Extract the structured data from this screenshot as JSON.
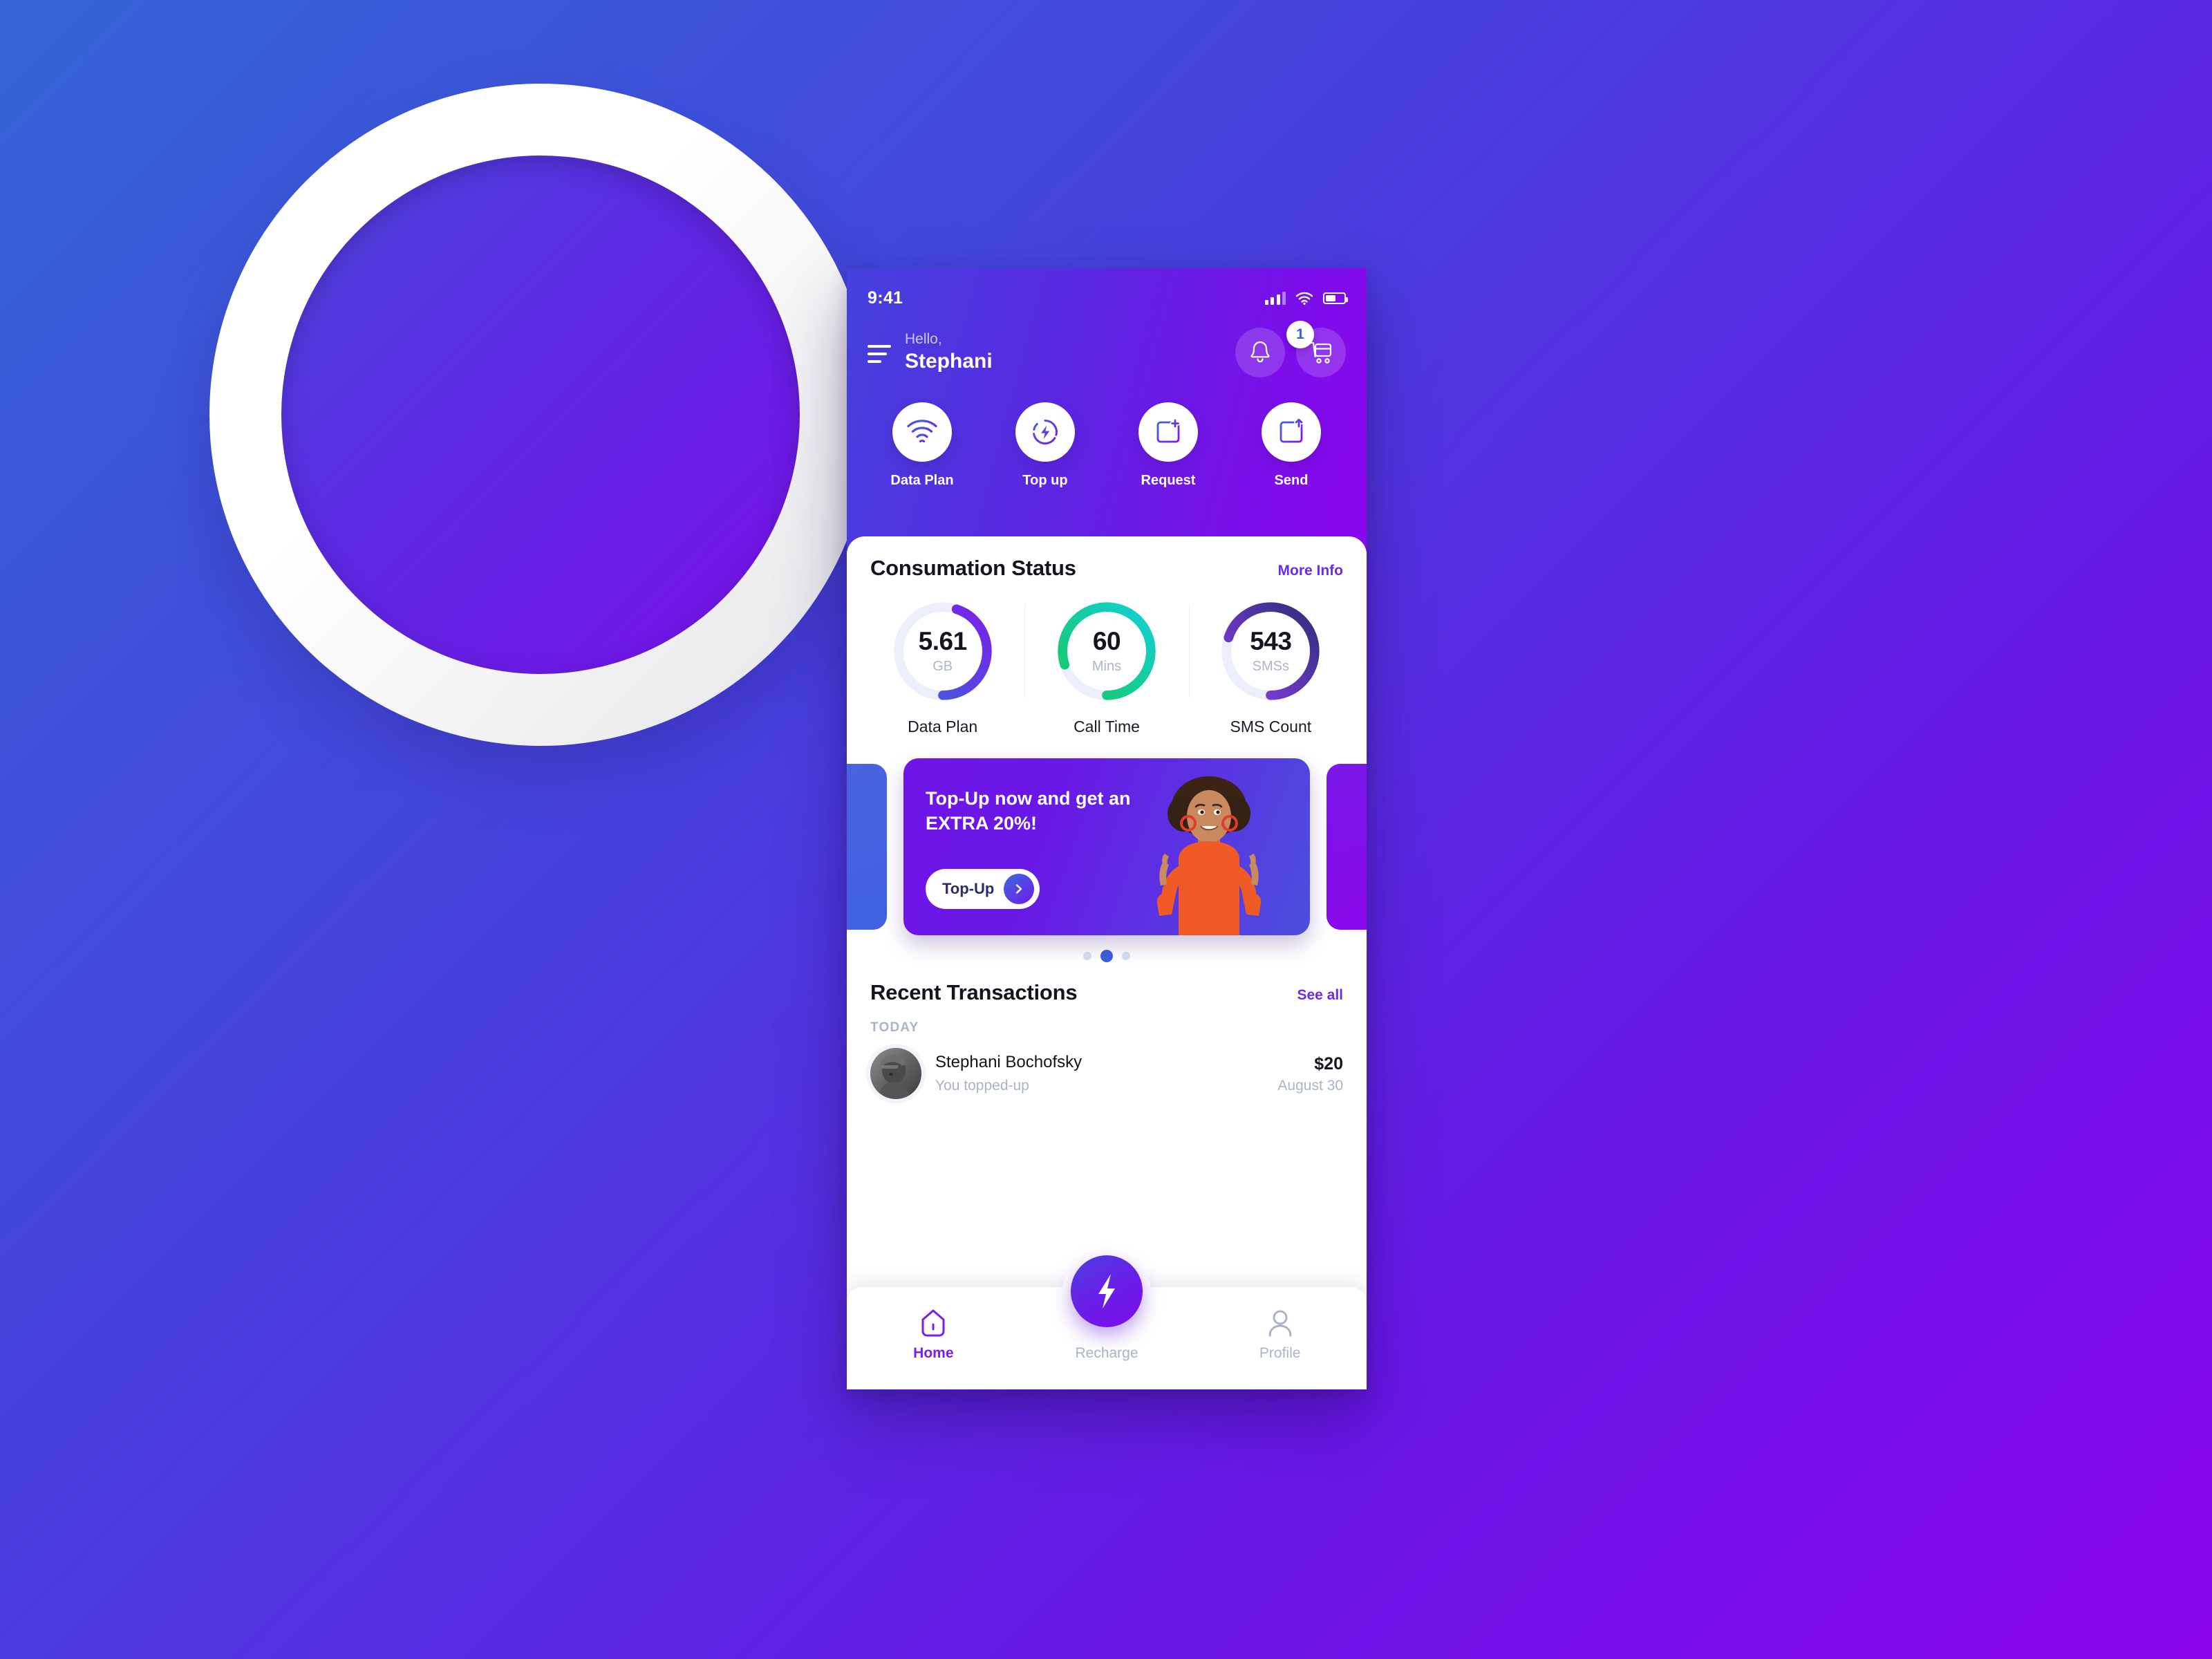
{
  "background": {
    "gradient_from": "#3565d8",
    "gradient_to": "#8a05ec",
    "ring_color": "#ffffff"
  },
  "phone": {
    "status_bar": {
      "time": "9:41",
      "signal_icon": "signal-bars-icon",
      "wifi_icon": "wifi-icon",
      "battery_icon": "battery-icon",
      "battery_level": "55"
    },
    "header": {
      "menu_icon": "hamburger-menu-icon",
      "greeting": "Hello,",
      "user_name": "Stephani",
      "bell_icon": "bell-icon",
      "cart_icon": "shopping-cart-icon",
      "cart_badge": "1"
    },
    "quick_actions": [
      {
        "label": "Data Plan",
        "icon": "wifi-signal-icon"
      },
      {
        "label": "Top up",
        "icon": "lightning-bolt-circle-icon"
      },
      {
        "label": "Request",
        "icon": "card-plus-icon"
      },
      {
        "label": "Send",
        "icon": "card-arrow-up-icon"
      }
    ],
    "consumption": {
      "title": "Consumation Status",
      "more_info": "More Info",
      "metrics": [
        {
          "value": "5.61",
          "unit": "GB",
          "label": "Data Plan",
          "percent": 45,
          "color_start": "#3a64da",
          "color_end": "#7b1fe8"
        },
        {
          "value": "60",
          "unit": "Mins",
          "label": "Call Time",
          "percent": 80,
          "color_start": "#16c95f",
          "color_end": "#14cfd8"
        },
        {
          "value": "543",
          "unit": "SMSs",
          "label": "SMS Count",
          "percent": 70,
          "color_start": "#8a3de8",
          "color_end": "#2e2d7a"
        }
      ],
      "track_color": "#eceffa"
    },
    "banner": {
      "headline": "Top-Up now and get an EXTRA 20%!",
      "cta_label": "Top-Up",
      "cta_icon": "chevron-right-icon",
      "illustration": "woman-pointing-up-photo",
      "dots": [
        "inactive",
        "active",
        "inactive"
      ]
    },
    "transactions": {
      "title": "Recent Transactions",
      "see_all": "See all",
      "group_label": "TODAY",
      "rows": [
        {
          "avatar": "user-avatar",
          "name": "Stephani Bochofsky",
          "subtitle": "You topped-up",
          "amount": "$20",
          "date": "August 30"
        }
      ]
    },
    "tabbar": {
      "items": [
        {
          "label": "Home",
          "icon": "home-icon",
          "active": true
        },
        {
          "label": "Recharge",
          "icon": "bolt-icon",
          "active": false
        },
        {
          "label": "Profile",
          "icon": "person-icon",
          "active": false
        }
      ],
      "fab_icon": "lightning-bolt-icon",
      "active_color": "#7a1ee9",
      "inactive_color": "#aab4c6"
    }
  }
}
